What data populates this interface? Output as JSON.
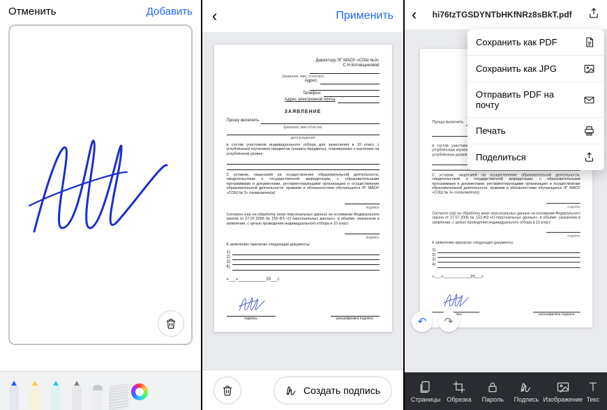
{
  "panel1": {
    "cancel": "Отменить",
    "add": "Добавить",
    "trash_icon": "trash",
    "tools": [
      "pen-blue",
      "marker-yellow",
      "pen-aqua",
      "pencil",
      "eraser",
      "ruler",
      "color-picker"
    ]
  },
  "panel2": {
    "apply": "Применить",
    "create_signature": "Создать подпись",
    "doc": {
      "recipient1": "Директору   ЛГ   МАОУ   «СОШ   №3»",
      "recipient2": "С.Н.Котовщиковой",
      "from_label": "(фамилия, имя, отчество)",
      "address_label": "Адрес:",
      "phone_label": "Телефон:",
      "email_label": "Адрес электронной почты",
      "title": "ЗАЯВЛЕНИЕ",
      "ask": "Прошу включить",
      "fio_label": "фамилия, имя отчество",
      "dob_label": "дата рождения",
      "body1": "в состав участников индивидуального отбора для зачисления в 10 класс с углублённым изучением предметов (указать предметы), планируемых к изучению на углублённом уровне:",
      "body2": "С уставом, лицензией на осуществление образовательной деятельности, свидетельством о государственной аккредитации, с образовательными программами и документами, регламентирующими организацию и осуществление образовательной деятельности, правами и обязанностями обучающихся ЛГ МАОУ «СОШ № 3» ознакомлен(а)",
      "body3": "Согласен (на) на обработку моих персональных данных на основании Федерального закона от 27.07.2006 № 152-ФЗ «О персональных данных», в объёме, указанном в заявлении, с целью проведения индивидуального отбора в 10 класс",
      "attach": "К заявлению прилагаю следующие документы:",
      "items": [
        "1)",
        "2)",
        "3)",
        "4)"
      ],
      "date_tmpl": "«___»____________20___г.",
      "sig_label": "подпись",
      "sig_decode": "расшифровка подписи",
      "consent_sig": "подпись"
    }
  },
  "panel3": {
    "filename": "hi76tzTGSDYNTbHKfNRz8sBkT.pdf",
    "menu": [
      {
        "label": "Сохранить как PDF",
        "icon": "file"
      },
      {
        "label": "Сохранить как JPG",
        "icon": "image"
      },
      {
        "label": "Отправить PDF на почту",
        "icon": "mail"
      },
      {
        "label": "Печать",
        "icon": "print"
      },
      {
        "label": "Поделиться",
        "icon": "share"
      }
    ],
    "tabs": [
      {
        "label": "Страницы",
        "icon": "pages"
      },
      {
        "label": "Обрезка",
        "icon": "crop"
      },
      {
        "label": "Пароль",
        "icon": "lock"
      },
      {
        "label": "Подпись",
        "icon": "signature"
      },
      {
        "label": "Изображение",
        "icon": "image"
      },
      {
        "label": "Текст",
        "icon": "text"
      }
    ]
  }
}
